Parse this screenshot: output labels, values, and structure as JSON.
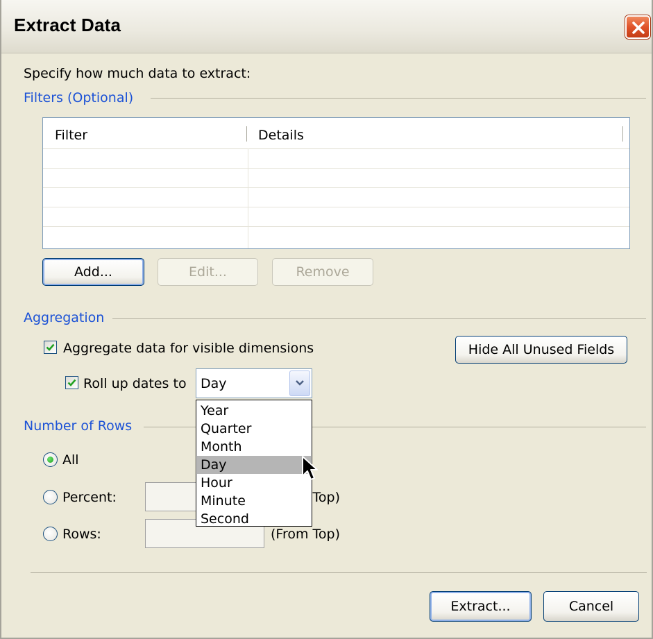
{
  "window": {
    "title": "Extract Data"
  },
  "intro": "Specify how much data to extract:",
  "filters": {
    "section_label": "Filters (Optional)",
    "columns": [
      "Filter",
      "Details"
    ],
    "rows": [],
    "buttons": {
      "add": "Add...",
      "edit": "Edit...",
      "remove": "Remove"
    }
  },
  "aggregation": {
    "section_label": "Aggregation",
    "aggregate_label": "Aggregate data for visible dimensions",
    "aggregate_checked": true,
    "rollup_label": "Roll up dates to",
    "rollup_checked": true,
    "rollup_value": "Day",
    "rollup_options": [
      "Year",
      "Quarter",
      "Month",
      "Day",
      "Hour",
      "Minute",
      "Second"
    ],
    "rollup_highlighted": "Day",
    "hide_unused_button": "Hide All Unused Fields"
  },
  "rows": {
    "section_label": "Number of Rows",
    "options": {
      "all": "All",
      "percent": "Percent:",
      "rows": "Rows:"
    },
    "selected": "All",
    "percent_suffix": "(From Top)",
    "rows_suffix": "(From Top)"
  },
  "footer": {
    "extract": "Extract...",
    "cancel": "Cancel"
  },
  "colors": {
    "accent": "#1c52d6",
    "close": "#e0532a",
    "checkmark": "#21a121"
  }
}
